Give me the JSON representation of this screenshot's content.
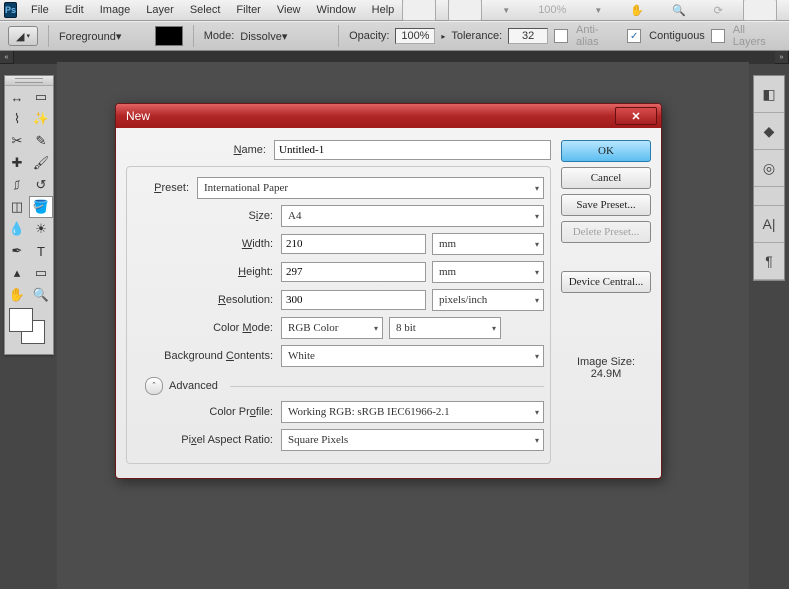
{
  "menu": {
    "items": [
      "File",
      "Edit",
      "Image",
      "Layer",
      "Select",
      "Filter",
      "View",
      "Window",
      "Help"
    ],
    "right": {
      "zoom": "100%"
    }
  },
  "options": {
    "fill_set": "Foreground",
    "mode_label": "Mode:",
    "mode_value": "Dissolve",
    "opacity_label": "Opacity:",
    "opacity_value": "100%",
    "tolerance_label": "Tolerance:",
    "tolerance_value": "32",
    "antialias": "Anti-alias",
    "contiguous": "Contiguous",
    "all_layers": "All Layers"
  },
  "dialog": {
    "title": "New",
    "name_label": "Name:",
    "name_value": "Untitled-1",
    "preset_label": "Preset:",
    "preset_value": "International Paper",
    "size_label": "Size:",
    "size_value": "A4",
    "width_label": "Width:",
    "width_value": "210",
    "width_unit": "mm",
    "height_label": "Height:",
    "height_value": "297",
    "height_unit": "mm",
    "res_label": "Resolution:",
    "res_value": "300",
    "res_unit": "pixels/inch",
    "mode_label": "Color Mode:",
    "mode_value": "RGB Color",
    "mode_depth": "8 bit",
    "bg_label": "Background Contents:",
    "bg_value": "White",
    "advanced": "Advanced",
    "profile_label": "Color Profile:",
    "profile_value": "Working RGB:  sRGB IEC61966-2.1",
    "par_label": "Pixel Aspect Ratio:",
    "par_value": "Square Pixels",
    "ok": "OK",
    "cancel": "Cancel",
    "save_preset": "Save Preset...",
    "delete_preset": "Delete Preset...",
    "device_central": "Device Central...",
    "imgsize_label": "Image Size:",
    "imgsize_value": "24.9M"
  }
}
